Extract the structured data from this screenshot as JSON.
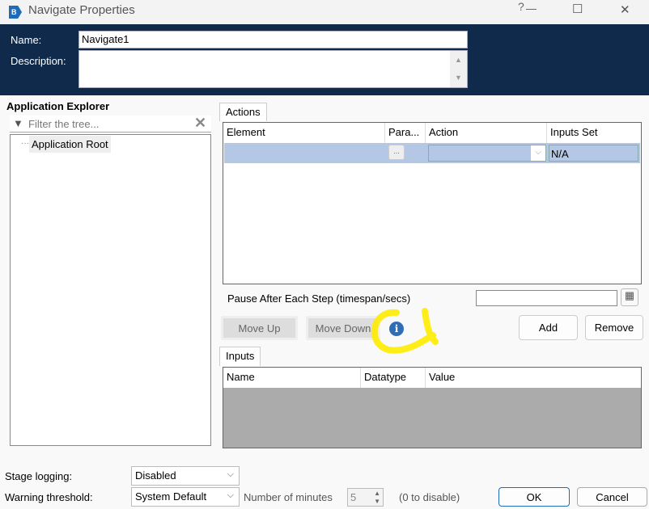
{
  "window": {
    "title": "Navigate Properties",
    "help": "?",
    "minimize": "—",
    "maximize": "☐",
    "close": "✕"
  },
  "header": {
    "name_label": "Name:",
    "name_value": "Navigate1",
    "description_label": "Description:",
    "description_value": ""
  },
  "explorer": {
    "title": "Application Explorer",
    "filter_placeholder": "Filter the tree...",
    "tree": [
      "Application Root"
    ]
  },
  "actions": {
    "tab": "Actions",
    "columns": [
      "Element",
      "Para...",
      "Action",
      "Inputs Set"
    ],
    "rows": [
      {
        "element": "",
        "params": "...",
        "action": "",
        "inputs_set": "N/A"
      }
    ],
    "pause_label": "Pause After Each Step (timespan/secs)",
    "pause_value": ""
  },
  "buttons": {
    "move_up": "Move Up",
    "move_down": "Move Down",
    "add": "Add",
    "remove": "Remove",
    "ok": "OK",
    "cancel": "Cancel"
  },
  "inputs": {
    "tab": "Inputs",
    "columns": [
      "Name",
      "Datatype",
      "Value"
    ]
  },
  "footer": {
    "stage_logging_label": "Stage logging:",
    "stage_logging_value": "Disabled",
    "warning_label": "Warning threshold:",
    "warning_value": "System Default",
    "minutes_label": "Number of minutes",
    "minutes_value": "5",
    "disable_hint": "(0 to disable)"
  },
  "colors": {
    "header": "#0f2a4a",
    "selection": "#b4c8e6",
    "annotation": "#ffeb00"
  }
}
